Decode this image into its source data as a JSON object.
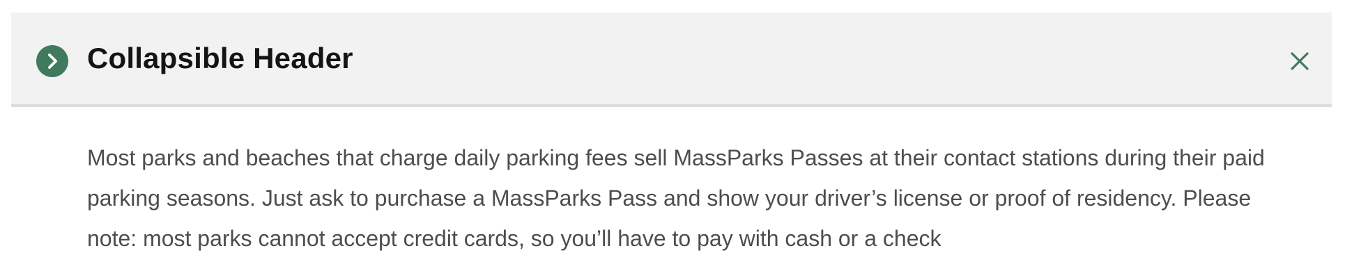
{
  "collapsible": {
    "title": "Collapsible Header",
    "expanded": true,
    "toggle_icon": "chevron-right-icon",
    "close_icon": "close-icon",
    "body_text": "Most parks and beaches that charge daily parking fees sell MassParks Passes at their contact stations during their paid parking seasons. Just ask to purchase a MassParks Pass and show your driver’s license or proof of residency. Please note: most parks cannot accept credit cards, so you’ll have to pay with cash or a check"
  },
  "colors": {
    "accent": "#3f7a5c",
    "header_background": "#f2f2f2",
    "header_border": "#dcdcdc",
    "title_text": "#141414",
    "body_text": "#4d4d4d"
  }
}
